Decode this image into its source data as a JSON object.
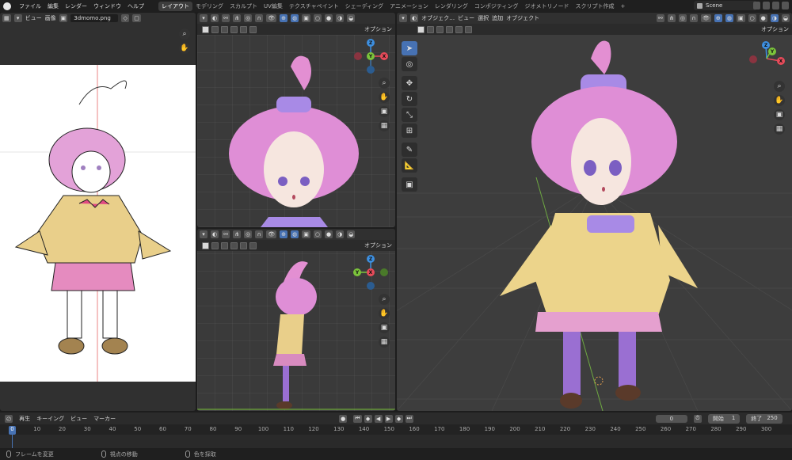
{
  "menu": [
    "ファイル",
    "編集",
    "レンダー",
    "ウィンドウ",
    "ヘルプ"
  ],
  "workspaces": [
    "レイアウト",
    "モデリング",
    "スカルプト",
    "UV編集",
    "テクスチャペイント",
    "シェーディング",
    "アニメーション",
    "レンダリング",
    "コンポジティング",
    "ジオメトリノード",
    "スクリプト作成"
  ],
  "active_workspace": "レイアウト",
  "scene": "Scene",
  "image_editor": {
    "view_label": "ビュー",
    "image_menu": "画像",
    "image_name": "3dmomo.png"
  },
  "viewport_options": "オプション",
  "main_viewport": {
    "mode": "オブジェク…",
    "menu": [
      "ビュー",
      "選択",
      "追加",
      "オブジェクト"
    ]
  },
  "gizmo_axes": {
    "x": "X",
    "y": "Y",
    "z": "Z"
  },
  "timeline": {
    "menu": [
      "再生",
      "キーイング",
      "ビュー",
      "マーカー"
    ],
    "current_frame": "0",
    "start_label": "開始",
    "start": "1",
    "end_label": "終了",
    "end": "250",
    "playhead": "0",
    "ticks": [
      "0",
      "10",
      "20",
      "30",
      "40",
      "50",
      "60",
      "70",
      "80",
      "90",
      "100",
      "110",
      "120",
      "130",
      "140",
      "150",
      "160",
      "170",
      "180",
      "190",
      "200",
      "210",
      "220",
      "230",
      "240",
      "250",
      "260",
      "270",
      "280",
      "290",
      "300"
    ]
  },
  "status": [
    "フレームを変更",
    "視点の移動",
    "色を採取"
  ],
  "colors": {
    "accent": "#4772b3",
    "axis_x": "#e84b5a",
    "axis_y": "#7bc43b",
    "axis_z": "#3d8fe0"
  }
}
